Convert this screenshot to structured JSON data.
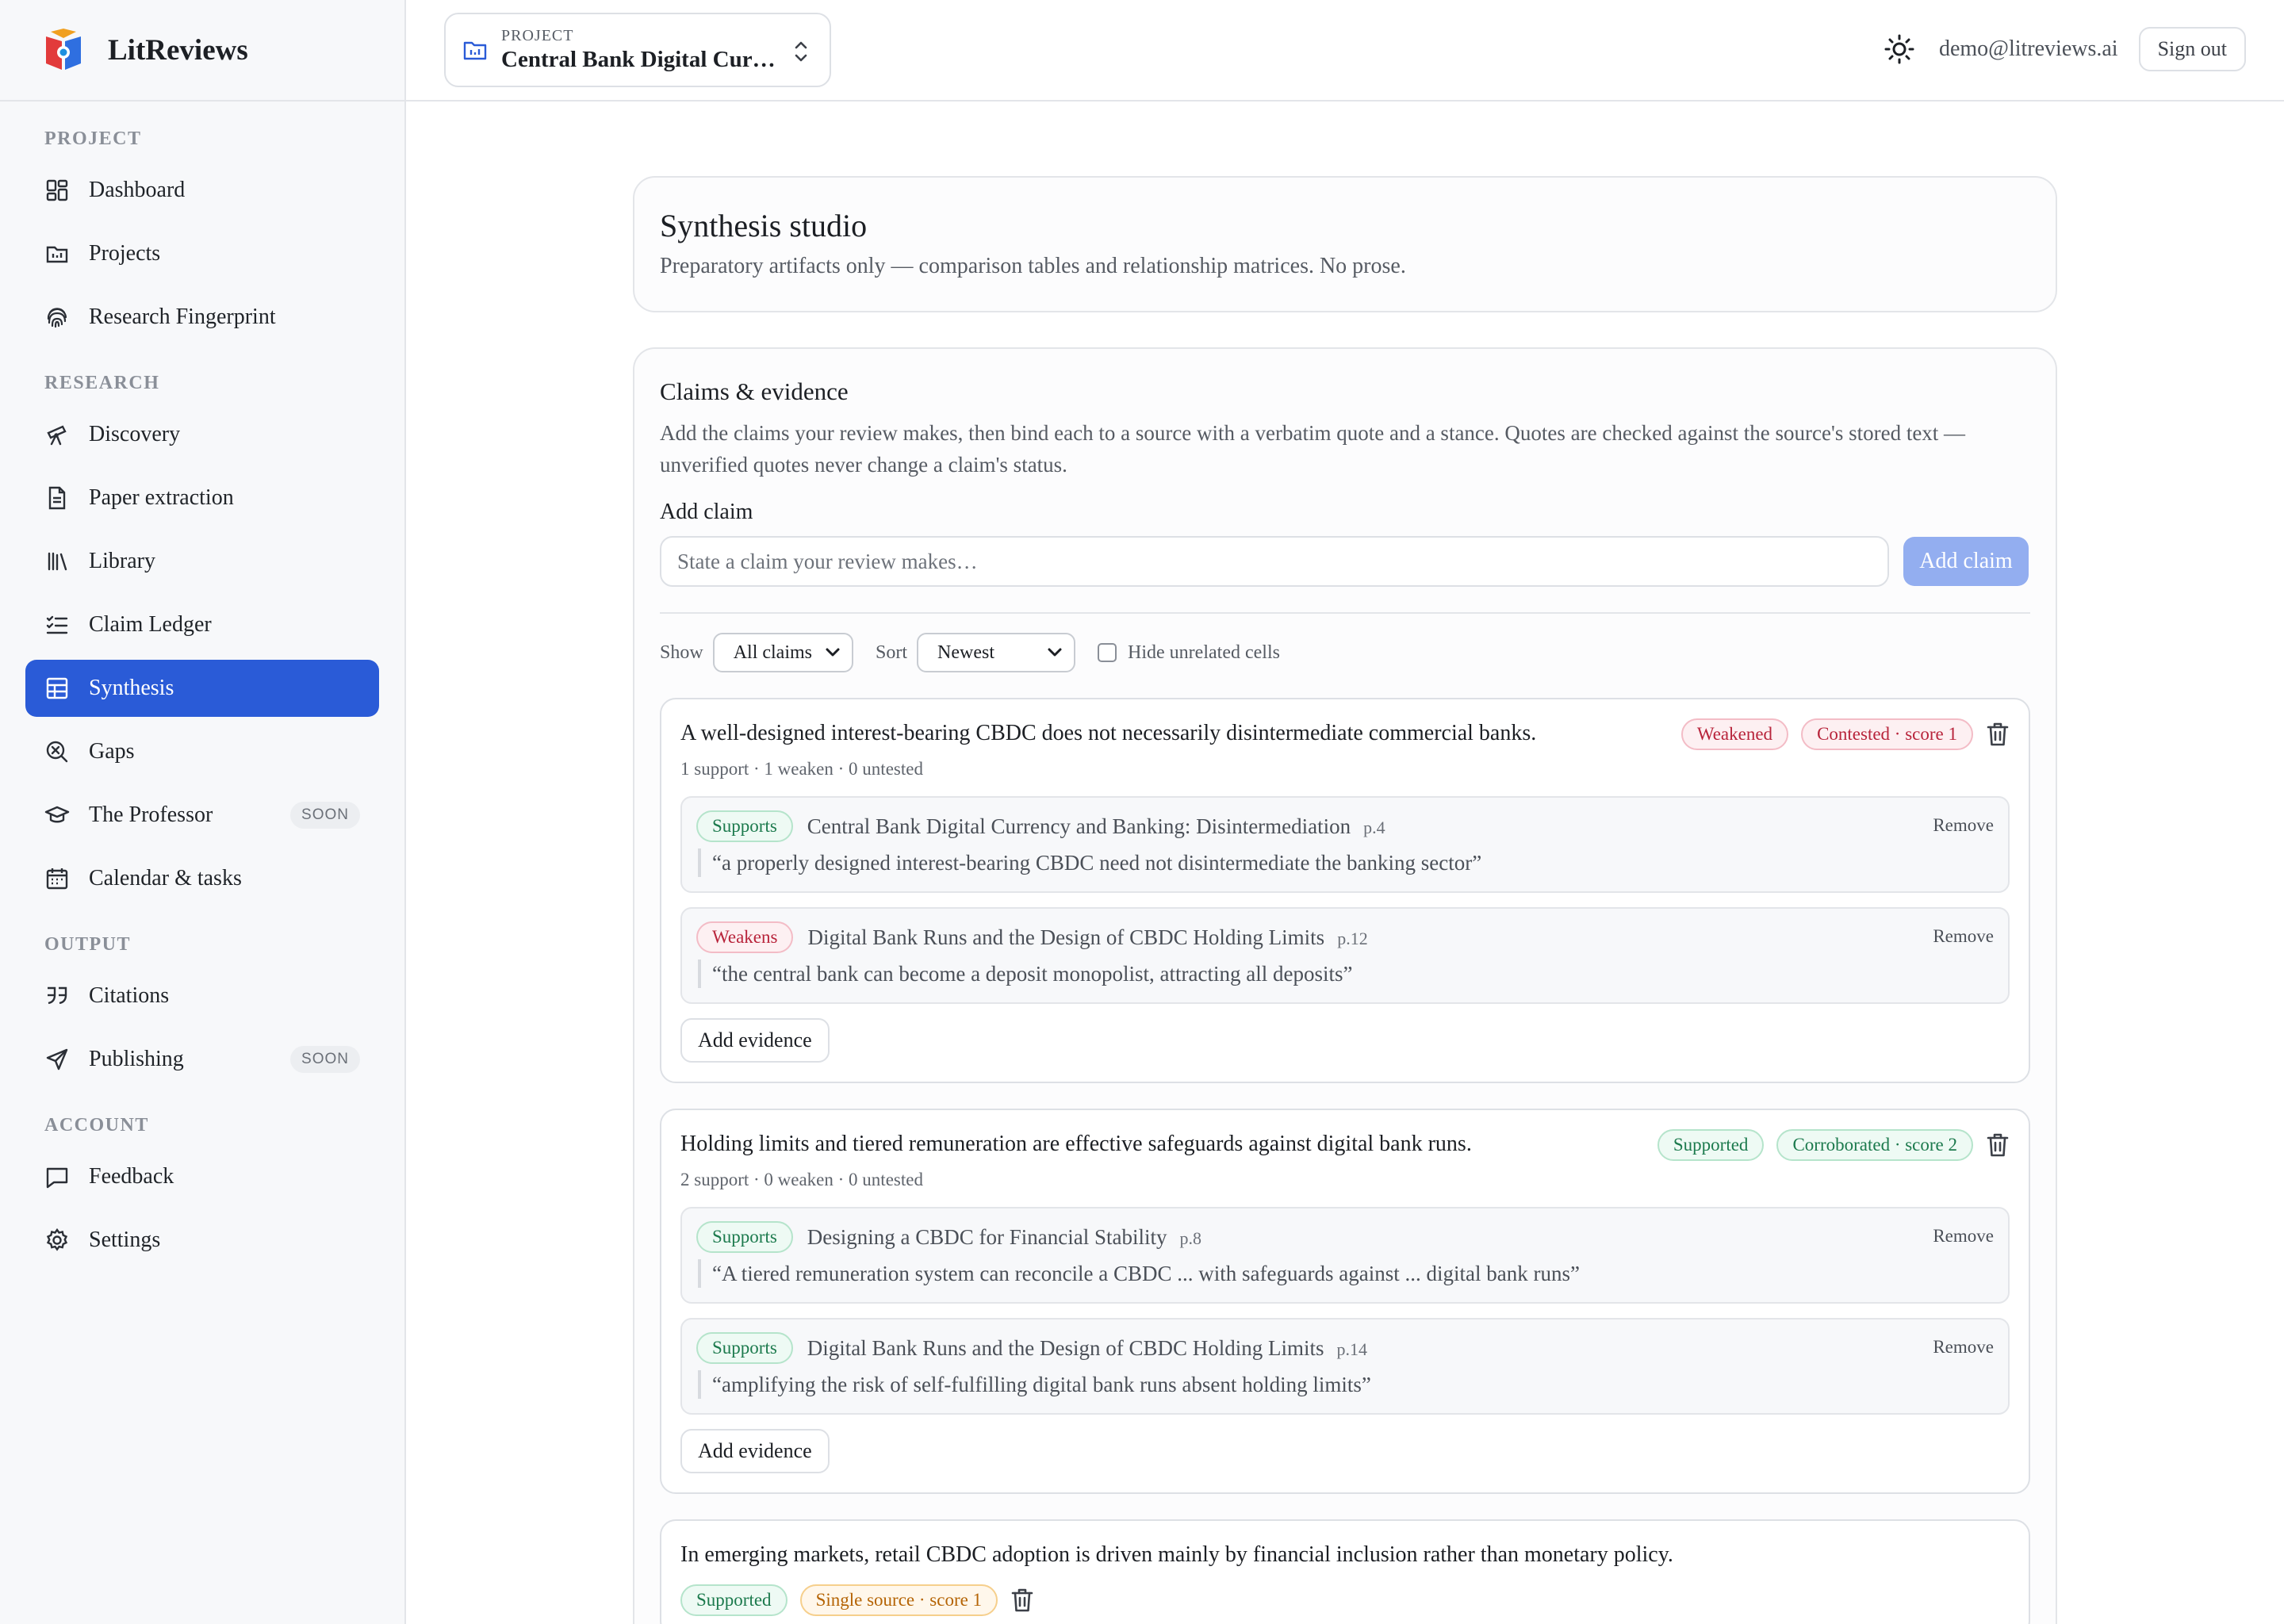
{
  "app": {
    "name": "LitReviews"
  },
  "topbar": {
    "project_label": "PROJECT",
    "project_name": "Central Bank Digital Curr…",
    "user_email": "demo@litreviews.ai",
    "signout_label": "Sign out"
  },
  "sidebar": {
    "sections": [
      {
        "label": "PROJECT",
        "items": [
          {
            "label": "Dashboard",
            "icon": "dashboard-icon"
          },
          {
            "label": "Projects",
            "icon": "projects-icon"
          },
          {
            "label": "Research Fingerprint",
            "icon": "fingerprint-icon"
          }
        ]
      },
      {
        "label": "RESEARCH",
        "items": [
          {
            "label": "Discovery",
            "icon": "telescope-icon"
          },
          {
            "label": "Paper extraction",
            "icon": "document-icon"
          },
          {
            "label": "Library",
            "icon": "library-icon"
          },
          {
            "label": "Claim Ledger",
            "icon": "checklist-icon"
          },
          {
            "label": "Synthesis",
            "icon": "table-icon",
            "active": true
          },
          {
            "label": "Gaps",
            "icon": "search-x-icon"
          },
          {
            "label": "The Professor",
            "icon": "graduation-cap-icon",
            "badge": "SOON"
          },
          {
            "label": "Calendar & tasks",
            "icon": "calendar-icon"
          }
        ]
      },
      {
        "label": "OUTPUT",
        "items": [
          {
            "label": "Citations",
            "icon": "quote-icon"
          },
          {
            "label": "Publishing",
            "icon": "send-icon",
            "badge": "SOON"
          }
        ]
      },
      {
        "label": "ACCOUNT",
        "items": [
          {
            "label": "Feedback",
            "icon": "message-icon"
          },
          {
            "label": "Settings",
            "icon": "gear-icon"
          }
        ]
      }
    ]
  },
  "hero": {
    "title": "Synthesis studio",
    "subtitle": "Preparatory artifacts only — comparison tables and relationship matrices. No prose."
  },
  "claims": {
    "title": "Claims & evidence",
    "description": "Add the claims your review makes, then bind each to a source with a verbatim quote and a stance. Quotes are checked against the source's stored text — unverified quotes never change a claim's status.",
    "add_label": "Add claim",
    "input_placeholder": "State a claim your review makes…",
    "add_button": "Add claim",
    "filters": {
      "show_label": "Show",
      "show_value": "All claims",
      "sort_label": "Sort",
      "sort_value": "Newest",
      "hide_label": "Hide unrelated cells"
    },
    "add_evidence_label": "Add evidence",
    "remove_label": "Remove",
    "items": [
      {
        "text": "A well-designed interest-bearing CBDC does not necessarily disintermediate commercial banks.",
        "status": "Weakened",
        "status_color": "red",
        "score_label": "Contested · score 1",
        "score_color": "red",
        "stats": "1 support · 1 weaken · 0 untested",
        "evidence": [
          {
            "stance": "Supports",
            "stance_color": "green",
            "title": "Central Bank Digital Currency and Banking: Disintermediation",
            "page": "p.4",
            "quote": "“a properly designed interest-bearing CBDC need not disintermediate the banking sector”"
          },
          {
            "stance": "Weakens",
            "stance_color": "red",
            "title": "Digital Bank Runs and the Design of CBDC Holding Limits",
            "page": "p.12",
            "quote": "“the central bank can become a deposit monopolist, attracting all deposits”"
          }
        ]
      },
      {
        "text": "Holding limits and tiered remuneration are effective safeguards against digital bank runs.",
        "status": "Supported",
        "status_color": "green",
        "score_label": "Corroborated · score 2",
        "score_color": "green",
        "stats": "2 support · 0 weaken · 0 untested",
        "evidence": [
          {
            "stance": "Supports",
            "stance_color": "green",
            "title": "Designing a CBDC for Financial Stability",
            "page": "p.8",
            "quote": "“A tiered remuneration system can reconcile a CBDC ... with safeguards against ... digital bank runs”"
          },
          {
            "stance": "Supports",
            "stance_color": "green",
            "title": "Digital Bank Runs and the Design of CBDC Holding Limits",
            "page": "p.14",
            "quote": "“amplifying the risk of self-fulfilling digital bank runs absent holding limits”"
          }
        ]
      },
      {
        "text": "In emerging markets, retail CBDC adoption is driven mainly by financial inclusion rather than monetary policy.",
        "status": "Supported",
        "status_color": "green",
        "score_label": "Single source · score 1",
        "score_color": "amber",
        "stats": "",
        "evidence": []
      }
    ]
  }
}
